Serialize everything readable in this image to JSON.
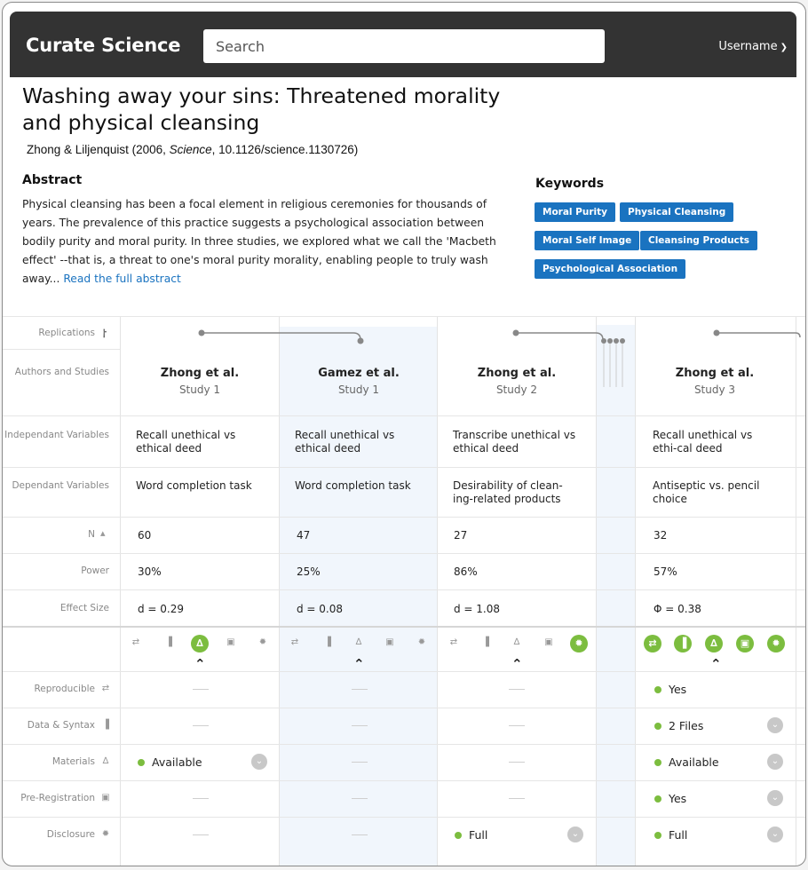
{
  "app": {
    "brand": "Curate Science",
    "search_placeholder": "Search",
    "username": "Username"
  },
  "article": {
    "title": "Washing away your sins: Threatened morality and physical cleansing",
    "authors": "Zhong & Liljenquist (2006, ",
    "journal": "Science",
    "doi": ", 10.1126/science.1130726)",
    "abstract_heading": "Abstract",
    "abstract_text": "Physical cleansing has been a focal element in religious ceremonies for thousands of years. The prevalence of this practice suggests a psychological association between bodily purity and moral purity. In three studies, we explored what we call the 'Macbeth effect' --that is, a threat to one's moral purity morality, enabling people to truly wash away...",
    "read_more": "Read the full abstract",
    "keywords_heading": "Keywords",
    "keywords": [
      "Moral Purity",
      "Physical Cleansing",
      "Moral Self Image",
      "Cleansing Products",
      "Psychological Association"
    ]
  },
  "row_labels": {
    "replications": "Replications",
    "authors": "Authors and Studies",
    "iv": "Independant Variables",
    "dv": "Dependant Variables",
    "n": "N",
    "power": "Power",
    "effect": "Effect Size",
    "reproducible": "Reproducible",
    "data": "Data & Syntax",
    "materials": "Materials",
    "prereg": "Pre-Registration",
    "disclosure": "Disclosure"
  },
  "studies": [
    {
      "author": "Zhong et al.",
      "study": "Study 1",
      "iv": "Recall unethical vs ethical deed",
      "dv": "Word completion task",
      "n": "60",
      "power": "30%",
      "effect": "d = 0.29",
      "materials": "Available",
      "disclosure": ""
    },
    {
      "author": "Gamez et al.",
      "study": "Study 1",
      "iv": "Recall unethical vs ethical deed",
      "dv": "Word completion task",
      "n": "47",
      "power": "25%",
      "effect": "d = 0.08"
    },
    {
      "author": "Zhong et al.",
      "study": "Study 2",
      "iv": "Transcribe unethical vs ethical deed",
      "dv": "Desirability of clean-ing-related products",
      "n": "27",
      "power": "86%",
      "effect": "d = 1.08",
      "disclosure": "Full"
    },
    {
      "author": "Zhong et al.",
      "study": "Study 3",
      "iv": "Recall unethical vs ethi-cal deed",
      "dv": "Antiseptic vs. pencil choice",
      "n": "32",
      "power": "57%",
      "effect": "Φ = 0.38",
      "reproducible": "Yes",
      "data": "2 Files",
      "materials": "Available",
      "prereg": "Yes",
      "disclosure": "Full"
    }
  ],
  "icons": [
    "reproducible-icon",
    "data-icon",
    "materials-icon",
    "prereg-icon",
    "disclosure-icon"
  ],
  "colors": {
    "accent": "#1a73c0",
    "badge_green": "#7cbd3f",
    "topbar": "#333333"
  }
}
